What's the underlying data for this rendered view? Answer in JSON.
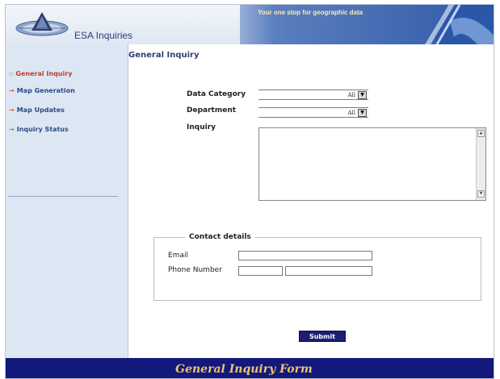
{
  "header": {
    "brand": "ESA Inquiries",
    "tagline": "Your one stop for geographic data"
  },
  "sidebar": {
    "items": [
      {
        "label": "General Inquiry",
        "active": true
      },
      {
        "label": "Map Generation",
        "active": false
      },
      {
        "label": "Map Updates",
        "active": false
      },
      {
        "label": "Inquiry Status",
        "active": false
      }
    ]
  },
  "main": {
    "title": "General Inquiry",
    "fields": {
      "data_category_label": "Data Category",
      "data_category_value": "All",
      "department_label": "Department",
      "department_value": "All",
      "inquiry_label": "Inquiry",
      "inquiry_value": ""
    },
    "contact": {
      "legend": "Contact details",
      "email_label": "Email",
      "email_value": "",
      "phone_label": "Phone Number",
      "phone_area_value": "",
      "phone_number_value": ""
    },
    "submit_label": "Submit"
  },
  "footer": {
    "text": "General Inquiry Form"
  },
  "colors": {
    "footer_bg": "#12187c",
    "footer_text": "#f0c36a",
    "sidebar_bg": "#dde7f4",
    "submit_bg": "#1b1f73",
    "active_nav": "#c53a2a"
  }
}
